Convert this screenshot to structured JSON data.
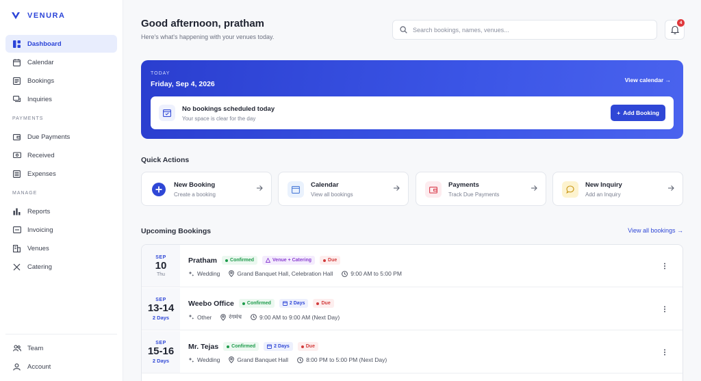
{
  "brand": {
    "name": "VENURA",
    "accent": "#2b44d8"
  },
  "nav": {
    "main": [
      {
        "label": "Dashboard",
        "icon": "dashboard-icon",
        "active": true
      },
      {
        "label": "Calendar",
        "icon": "calendar-icon"
      },
      {
        "label": "Bookings",
        "icon": "bookings-icon"
      },
      {
        "label": "Inquiries",
        "icon": "inquiries-icon"
      }
    ],
    "payments_label": "PAYMENTS",
    "payments": [
      {
        "label": "Due Payments",
        "icon": "wallet-icon"
      },
      {
        "label": "Received",
        "icon": "cash-icon"
      },
      {
        "label": "Expenses",
        "icon": "receipt-icon"
      }
    ],
    "manage_label": "MANAGE",
    "manage": [
      {
        "label": "Reports",
        "icon": "bar-chart-icon"
      },
      {
        "label": "Invoicing",
        "icon": "invoice-icon"
      },
      {
        "label": "Venues",
        "icon": "building-icon"
      },
      {
        "label": "Catering",
        "icon": "utensils-icon"
      }
    ],
    "bottom": [
      {
        "label": "Team",
        "icon": "team-icon"
      },
      {
        "label": "Account",
        "icon": "account-icon"
      }
    ]
  },
  "header": {
    "greeting": "Good afternoon, pratham",
    "subtitle": "Here's what's happening with your venues today.",
    "search_placeholder": "Search bookings, names, venues...",
    "notification_count": "4"
  },
  "today": {
    "label": "TODAY",
    "date": "Friday, Sep 4, 2026",
    "view_calendar": "View calendar →",
    "empty_title": "No bookings scheduled today",
    "empty_sub": "Your space is clear for the day",
    "add_booking": "Add Booking"
  },
  "quick_actions": {
    "title": "Quick Actions",
    "items": [
      {
        "title": "New Booking",
        "sub": "Create a booking"
      },
      {
        "title": "Calendar",
        "sub": "View all bookings"
      },
      {
        "title": "Payments",
        "sub": "Track Due Payments"
      },
      {
        "title": "New Inquiry",
        "sub": "Add an Inquiry"
      }
    ]
  },
  "upcoming": {
    "title": "Upcoming Bookings",
    "view_all": "View all bookings →",
    "rows": [
      {
        "month": "SEP",
        "day": "10",
        "sub": "Thu",
        "name": "Pratham",
        "status": "Confirmed",
        "extra": "Venue + Catering",
        "payment": "Due",
        "event": "Wedding",
        "venue": "Grand Banquet Hall, Celebration Hall",
        "time": "9:00 AM to 5:00 PM"
      },
      {
        "month": "SEP",
        "day": "13-14",
        "sub": "2 Days",
        "name": "Weebo Office",
        "status": "Confirmed",
        "extra": "2 Days",
        "payment": "Due",
        "event": "Other",
        "venue": "रंगमंच",
        "time": "9:00 AM to 9:00 AM (Next Day)"
      },
      {
        "month": "SEP",
        "day": "15-16",
        "sub": "2 Days",
        "name": "Mr. Tejas",
        "status": "Confirmed",
        "extra": "2 Days",
        "payment": "Due",
        "event": "Wedding",
        "venue": "Grand Banquet Hall",
        "time": "8:00 PM to 5:00 PM (Next Day)"
      }
    ]
  }
}
